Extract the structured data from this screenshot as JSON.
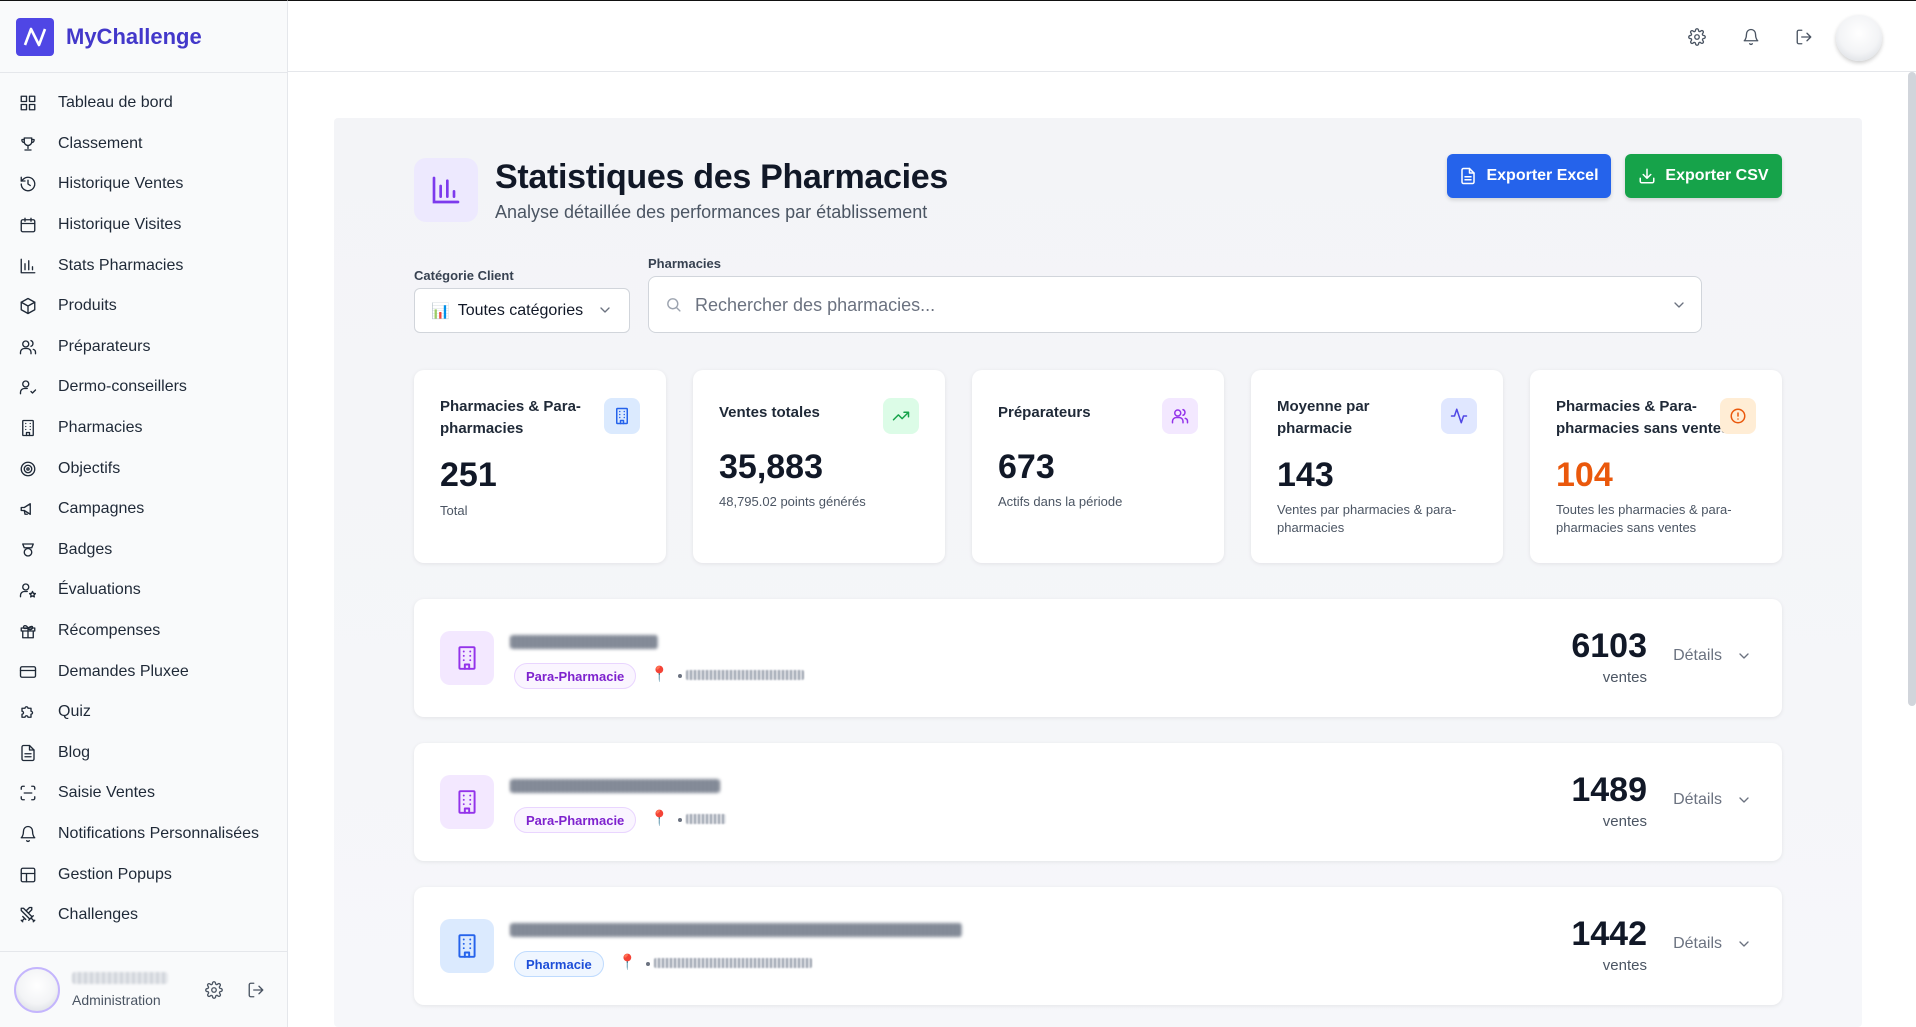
{
  "app": {
    "name": "MyChallenge"
  },
  "sidebar": {
    "items": [
      {
        "label": "Tableau de bord",
        "icon": "dashboard-icon"
      },
      {
        "label": "Classement",
        "icon": "trophy-icon"
      },
      {
        "label": "Historique Ventes",
        "icon": "history-icon"
      },
      {
        "label": "Historique Visites",
        "icon": "calendar-icon"
      },
      {
        "label": "Stats Pharmacies",
        "icon": "bar-chart-icon"
      },
      {
        "label": "Produits",
        "icon": "package-icon"
      },
      {
        "label": "Préparateurs",
        "icon": "users-icon"
      },
      {
        "label": "Dermo-conseillers",
        "icon": "user-check-icon"
      },
      {
        "label": "Pharmacies",
        "icon": "building-icon"
      },
      {
        "label": "Objectifs",
        "icon": "target-icon"
      },
      {
        "label": "Campagnes",
        "icon": "megaphone-icon"
      },
      {
        "label": "Badges",
        "icon": "badge-icon"
      },
      {
        "label": "Évaluations",
        "icon": "user-star-icon"
      },
      {
        "label": "Récompenses",
        "icon": "gift-icon"
      },
      {
        "label": "Demandes Pluxee",
        "icon": "credit-card-icon"
      },
      {
        "label": "Quiz",
        "icon": "puzzle-icon"
      },
      {
        "label": "Blog",
        "icon": "file-text-icon"
      },
      {
        "label": "Saisie Ventes",
        "icon": "scan-icon"
      },
      {
        "label": "Notifications Personnalisées",
        "icon": "bell-icon"
      },
      {
        "label": "Gestion Popups",
        "icon": "layout-icon"
      },
      {
        "label": "Challenges",
        "icon": "swords-icon"
      }
    ],
    "user": {
      "role": "Administration"
    }
  },
  "page": {
    "title": "Statistiques des Pharmacies",
    "subtitle": "Analyse détaillée des performances par établissement",
    "export_excel": "Exporter Excel",
    "export_csv": "Exporter CSV"
  },
  "filters": {
    "category_label": "Catégorie Client",
    "category_value": "Toutes catégories",
    "category_emoji": "📊",
    "pharmacies_label": "Pharmacies",
    "search_placeholder": "Rechercher des pharmacies..."
  },
  "stats": [
    {
      "label": "Pharmacies & Para-pharmacies",
      "value": "251",
      "sub": "Total",
      "icon": "building-icon",
      "accent": "#2563eb",
      "bg": "#dbeafe"
    },
    {
      "label": "Ventes totales",
      "value": "35,883",
      "sub": "48,795.02 points générés",
      "icon": "trending-up-icon",
      "accent": "#16a34a",
      "bg": "#dcfce7"
    },
    {
      "label": "Préparateurs",
      "value": "673",
      "sub": "Actifs dans la période",
      "icon": "users-icon",
      "accent": "#9333ea",
      "bg": "#f3e8ff"
    },
    {
      "label": "Moyenne par pharmacie",
      "value": "143",
      "sub": "Ventes par pharmacies & para-pharmacies",
      "icon": "activity-icon",
      "accent": "#4f46e5",
      "bg": "#e0e7ff"
    },
    {
      "label": "Pharmacies & Para-pharmacies sans ventes",
      "value": "104",
      "sub": "Toutes les pharmacies & para-pharmacies sans ventes",
      "icon": "alert-circle-icon",
      "accent": "#ea580c",
      "bg": "#ffedd5"
    }
  ],
  "pharmacies": [
    {
      "type": "Para-Pharmacie",
      "sales": "6103",
      "unit": "ventes",
      "details": "Détails",
      "pin": "📍"
    },
    {
      "type": "Para-Pharmacie",
      "sales": "1489",
      "unit": "ventes",
      "details": "Détails",
      "pin": "📍"
    },
    {
      "type": "Pharmacie",
      "sales": "1442",
      "unit": "ventes",
      "details": "Détails",
      "pin": "📍"
    }
  ]
}
